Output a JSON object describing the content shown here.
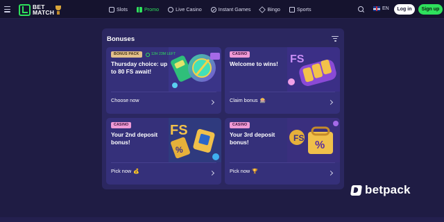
{
  "header": {
    "logo": {
      "line1": "BET",
      "line2": "MATCH"
    },
    "nav": [
      {
        "label": "Slots",
        "icon": "slot-machine-icon",
        "active": false
      },
      {
        "label": "Promo",
        "icon": "gift-icon",
        "active": true
      },
      {
        "label": "Live Casino",
        "icon": "live-casino-icon",
        "active": false
      },
      {
        "label": "Instant Games",
        "icon": "rocket-icon",
        "active": false
      },
      {
        "label": "Bingo",
        "icon": "bingo-icon",
        "active": false
      },
      {
        "label": "Sports",
        "icon": "sports-icon",
        "active": false
      }
    ],
    "language": "EN",
    "login_label": "Log in",
    "signup_label": "Sign up"
  },
  "bonuses": {
    "title": "Bonuses",
    "cards": [
      {
        "tag": "BONUS PACK",
        "timer": "12H 23M LEFT",
        "title": "Thursday choice: up to 80 FS await!",
        "action": "Choose now",
        "emoji": ""
      },
      {
        "tag": "CASINO",
        "timer": "",
        "title": "Welcome to wins!",
        "action": "Claim bonus",
        "emoji": "🎰"
      },
      {
        "tag": "CASINO",
        "timer": "",
        "title": "Your 2nd deposit bonus!",
        "action": "Pick now",
        "emoji": "💰"
      },
      {
        "tag": "CASINO",
        "timer": "",
        "title": "Your 3rd deposit bonus!",
        "action": "Pick now",
        "emoji": "🏆"
      }
    ]
  },
  "watermark": {
    "text": "betpack"
  },
  "colors": {
    "accent": "#2ee05c",
    "background": "#1f1c44",
    "panel": "#2b2760",
    "card": "#35307a",
    "bonus_pack_tag": "#e3c08a",
    "casino_tag": "#f09ad6"
  }
}
